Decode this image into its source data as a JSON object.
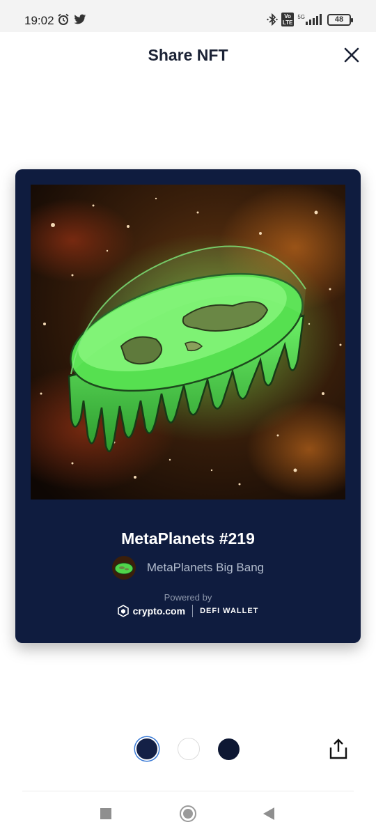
{
  "status_bar": {
    "time": "19:02",
    "left_icons": [
      "alarm-icon",
      "twitter-icon"
    ],
    "right_icons": [
      "bluetooth-icon",
      "volte-icon",
      "signal-icon",
      "battery-icon"
    ],
    "volte_label": "Vo\nLTE",
    "network_label": "5G",
    "battery_level": "48"
  },
  "header": {
    "title": "Share NFT",
    "close_icon": "close-icon"
  },
  "card": {
    "background": "#0f1c3f",
    "nft_title": "MetaPlanets #219",
    "collection_name": "MetaPlanets Big Bang",
    "powered_by": "Powered by",
    "brand_name": "crypto.com",
    "brand_product": "DEFI WALLET"
  },
  "themes": {
    "options": [
      {
        "name": "dark-blue",
        "color": "#142046",
        "selected": true
      },
      {
        "name": "white",
        "color": "#ffffff",
        "selected": false
      },
      {
        "name": "navy",
        "color": "#0d1733",
        "selected": false
      }
    ]
  },
  "actions": {
    "share_icon": "share-icon"
  },
  "nav": {
    "items": [
      "recents-button",
      "home-button",
      "back-button"
    ]
  }
}
